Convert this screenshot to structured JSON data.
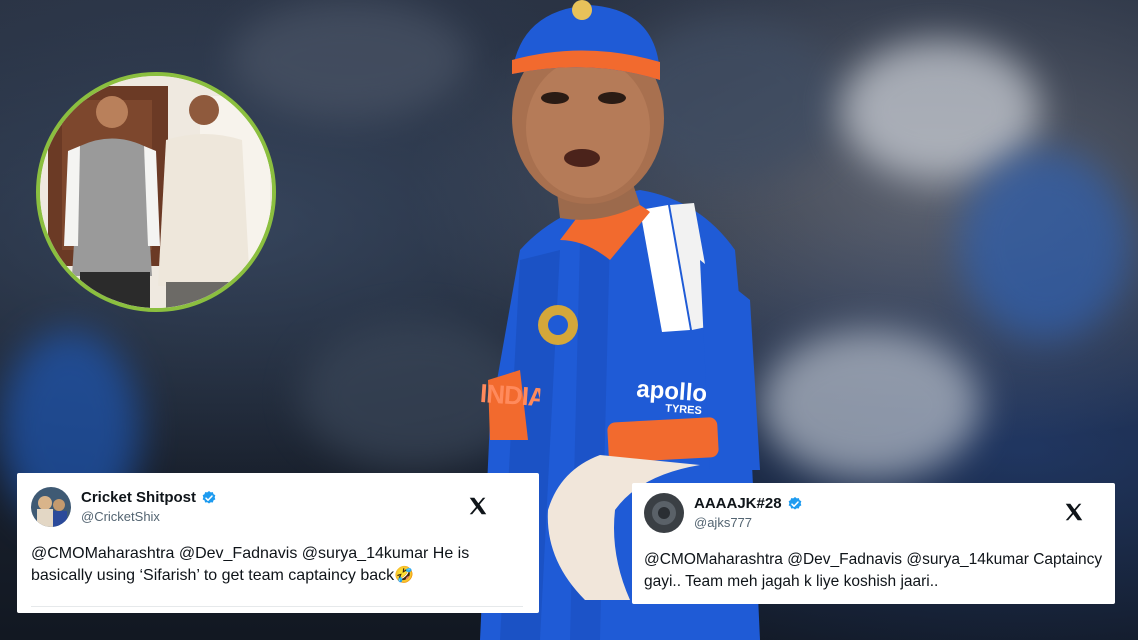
{
  "tweets": [
    {
      "name": "Cricket Shitpost",
      "handle": "@CricketShix",
      "text_line1": "@CMOMaharashtra @Dev_Fadnavis @surya_14kumar He is",
      "text_line2": "basically using ‘Sifarish’ to get team captaincy back🤣",
      "verified": true,
      "platform_icon": "x-logo-icon"
    },
    {
      "name": "AAAAJK#28",
      "handle": "@ajks777",
      "text_line1": "@CMOMaharashtra @Dev_Fadnavis @surya_14kumar Captaincy",
      "text_line2": "gayi.. Team meh jagah k liye koshish jaari..",
      "verified": true,
      "platform_icon": "x-logo-icon"
    }
  ],
  "jersey": {
    "sponsor_logo": "apollo",
    "sponsor_sub": "TYRES",
    "chest_text": "INDIA"
  },
  "colors": {
    "verified_blue": "#1d9bf0",
    "inset_border": "#8bbf3f",
    "jersey_blue": "#1f5bd6",
    "jersey_orange": "#f26a2e"
  }
}
